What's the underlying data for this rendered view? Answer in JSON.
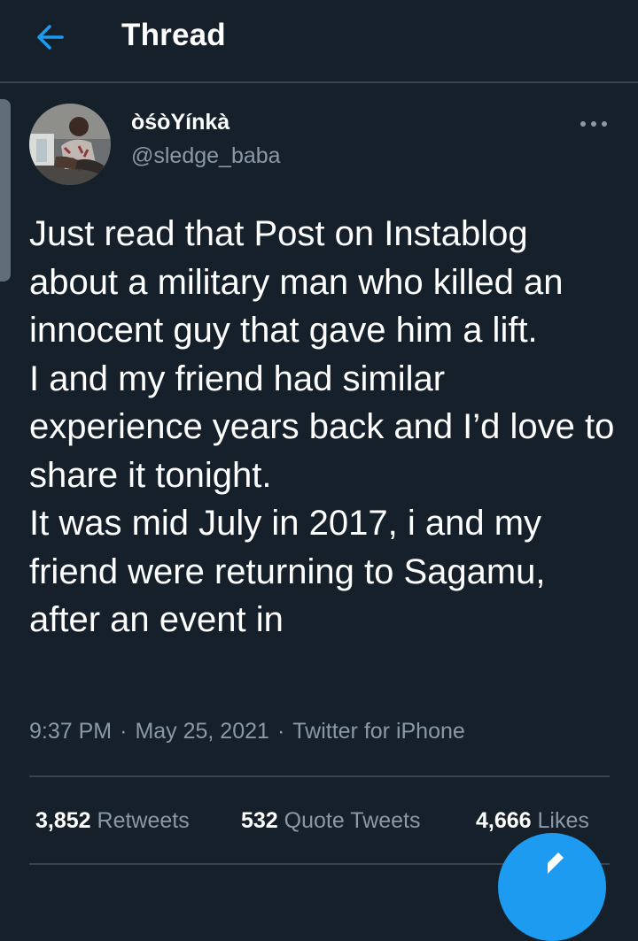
{
  "header": {
    "back_icon": "arrow-left-icon",
    "title": "Thread"
  },
  "tweet": {
    "author": {
      "display_name": "òśòYínkà",
      "handle": "@sledge_baba"
    },
    "more_icon": "more-dots-icon",
    "text": "Just read that Post on Instablog about a military man who killed an innocent guy that gave him a lift.\nI and my friend had similar experience years back and I’d love to share it tonight.\nIt was mid July in 2017, i and my friend were returning to Sagamu, after an event in",
    "time": "9:37 PM",
    "date": "May 25, 2021",
    "source": "Twitter for iPhone",
    "separator": "·"
  },
  "stats": {
    "retweets_count": "3,852",
    "retweets_label": "Retweets",
    "quotes_count": "532",
    "quotes_label": "Quote Tweets",
    "likes_count": "4,666",
    "likes_label": "Likes"
  },
  "fab": {
    "icon": "compose-tweet-icon"
  },
  "colors": {
    "background": "#15202b",
    "accent": "#1d9bf0",
    "secondary_text": "#8b98a5",
    "divider": "#38444d"
  }
}
